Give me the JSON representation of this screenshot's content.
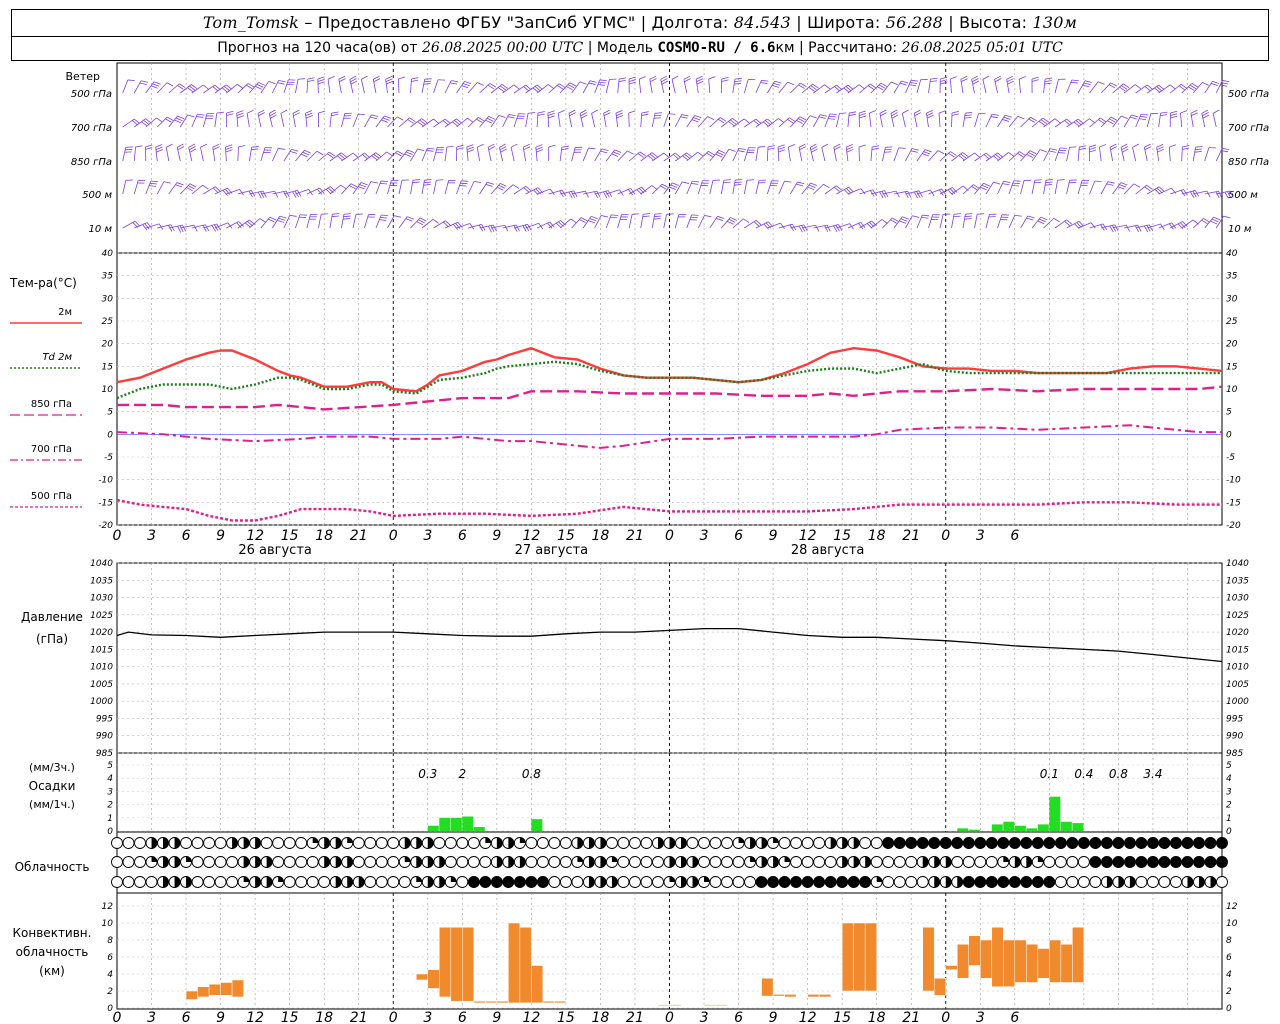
{
  "header": {
    "station": "Tom_Tomsk",
    "provider": " – Предоставлено ФГБУ \"ЗапСиб УГМС\" | Долгота: ",
    "lon": "84.543",
    "lat_label": " | Широта: ",
    "lat": "56.288",
    "alt_label": " | Высота: ",
    "alt": "130м",
    "forecast_label": "Прогноз на 120 часа(ов) от ",
    "forecast_time": "26.08.2025 00:00 UTC",
    "model_label": "  | Модель ",
    "model": "COSMO-RU / 6.6",
    "model_unit": "км",
    "calc_label": " | Рассчитано: ",
    "calc_time": "26.08.2025 05:01 UTC"
  },
  "time_axis": {
    "hour_labels": [
      "0",
      "3",
      "6",
      "9",
      "12",
      "15",
      "18",
      "21",
      "0",
      "3",
      "6",
      "9",
      "12",
      "15",
      "18",
      "21",
      "0",
      "3",
      "6",
      "9",
      "12",
      "15",
      "18",
      "21",
      "0",
      "3",
      "6"
    ],
    "day_labels": [
      {
        "text": "26 августа",
        "hour": 12
      },
      {
        "text": "27 августа",
        "hour": 36
      },
      {
        "text": "28 августа",
        "hour": 60
      }
    ]
  },
  "wind_panel": {
    "title": "Ветер",
    "levels": [
      "500 гПа",
      "700 гПа",
      "850 гПа",
      "500 м",
      "10 м"
    ],
    "color": "#7b3fe4"
  },
  "temp_panel": {
    "title": "Тем-ра(°C)",
    "legend": [
      {
        "label": "2м",
        "color": "#ff3b3b",
        "dash": "solid"
      },
      {
        "label": "2м",
        "prefix": "Td",
        "color": "#1a7f1a",
        "dash": "dotted"
      },
      {
        "label": "850 гПа",
        "color": "#e0208a",
        "dash": "long-dash"
      },
      {
        "label": "700 гПа",
        "color": "#e0208a",
        "dash": "dash-dot"
      },
      {
        "label": "500 гПа",
        "color": "#e0208a",
        "dash": "short-dash"
      }
    ],
    "y_ticks": [
      "40",
      "35",
      "30",
      "25",
      "20",
      "15",
      "10",
      "5",
      "0",
      "-5",
      "-10",
      "-15",
      "-20"
    ]
  },
  "pressure_panel": {
    "title": "Давление",
    "unit": "(гПа)",
    "y_ticks": [
      "1040",
      "1035",
      "1030",
      "1025",
      "1020",
      "1015",
      "1010",
      "1005",
      "1000",
      "995",
      "990",
      "985"
    ]
  },
  "precip_panel": {
    "unit_top": "(мм/3ч.)",
    "title": "Осадки",
    "unit_bottom": "(мм/1ч.)",
    "y_ticks": [
      "5",
      "4",
      "3",
      "2",
      "1",
      "0"
    ],
    "totals": [
      {
        "text": "0.3",
        "hour": 27
      },
      {
        "text": "2",
        "hour": 30
      },
      {
        "text": "0.8",
        "hour": 36
      },
      {
        "text": "0.1",
        "hour": 81
      },
      {
        "text": "0.4",
        "hour": 84
      },
      {
        "text": "0.8",
        "hour": 87
      },
      {
        "text": "3.4",
        "hour": 90
      }
    ],
    "color": "#22dd22"
  },
  "cloud_panel": {
    "title": "Облачность"
  },
  "conv_panel": {
    "title_lines": [
      "Конвективн.",
      "облачность",
      "(км)"
    ],
    "y_ticks": [
      "12",
      "10",
      "8",
      "6",
      "4",
      "2",
      "0"
    ],
    "color": "#f08a2c"
  },
  "chart_data": [
    {
      "type": "line",
      "title": "Тем-ра(°C)",
      "x_unit": "hours from 26.08.2025 00:00 UTC",
      "ylim": [
        -20,
        40
      ],
      "series": [
        {
          "name": "2м",
          "x": [
            0,
            2,
            4,
            6,
            8,
            9,
            10,
            12,
            14,
            15,
            16,
            18,
            20,
            22,
            23,
            24,
            26,
            27,
            28,
            30,
            32,
            33,
            34,
            36,
            38,
            40,
            42,
            44,
            46,
            48,
            50,
            52,
            54,
            56,
            58,
            60,
            62,
            63,
            64,
            66,
            68,
            70,
            72,
            74,
            76,
            78,
            80,
            82,
            84,
            86,
            88,
            90,
            92,
            94,
            96
          ],
          "y": [
            11.5,
            12.5,
            14.5,
            16.5,
            18,
            18.5,
            18.5,
            16.5,
            14,
            13,
            12.5,
            10.5,
            10.5,
            11.5,
            11.5,
            10,
            9.5,
            11,
            13,
            14,
            16,
            16.5,
            17.5,
            19,
            17,
            16.5,
            14.5,
            13,
            12.5,
            12.5,
            12.5,
            12,
            11.5,
            12,
            13.5,
            15.5,
            18,
            18.5,
            19,
            18.5,
            17,
            15,
            14.5,
            14.5,
            14,
            14,
            13.5,
            13.5,
            13.5,
            13.5,
            14.5,
            15,
            15,
            14.5,
            14
          ]
        },
        {
          "name": "Td 2м",
          "x": [
            0,
            2,
            4,
            6,
            8,
            9,
            10,
            12,
            14,
            15,
            16,
            18,
            20,
            22,
            23,
            24,
            26,
            27,
            28,
            30,
            32,
            33,
            34,
            36,
            38,
            40,
            42,
            44,
            46,
            48,
            50,
            52,
            54,
            56,
            58,
            60,
            62,
            63,
            64,
            66,
            68,
            70,
            72,
            74,
            76,
            78,
            80,
            82,
            84,
            86,
            88,
            90,
            92,
            94,
            96
          ],
          "y": [
            8,
            10,
            11,
            11,
            11,
            10.5,
            10,
            11,
            12.5,
            12.5,
            12,
            10,
            10,
            11,
            11,
            9.5,
            9,
            10.5,
            12,
            12.5,
            13.5,
            14.5,
            15,
            15.5,
            16,
            15.5,
            14,
            13,
            12.5,
            12.5,
            12.5,
            12,
            11.5,
            12,
            13,
            14,
            14.5,
            14.5,
            14.5,
            13.5,
            14.5,
            15.5,
            14,
            13.5,
            13.5,
            13.5,
            13.5,
            13.5,
            13.5,
            13.5,
            13.5,
            13.5,
            13.5,
            13.5,
            13.5
          ]
        },
        {
          "name": "850 гПа",
          "x": [
            0,
            4,
            6,
            8,
            12,
            14,
            16,
            18,
            24,
            28,
            30,
            32,
            34,
            36,
            40,
            44,
            48,
            52,
            56,
            60,
            62,
            64,
            66,
            68,
            72,
            76,
            80,
            84,
            88,
            92,
            94,
            96
          ],
          "y": [
            6.5,
            6.5,
            6,
            6,
            6,
            6.5,
            6,
            5.5,
            6.5,
            7.5,
            8,
            8,
            8,
            9.5,
            9.5,
            9,
            9,
            9,
            8.5,
            8.5,
            9,
            8.5,
            9,
            9.5,
            9.5,
            10,
            9.5,
            10,
            10,
            10,
            10,
            10.5
          ]
        },
        {
          "name": "700 гПа",
          "x": [
            0,
            4,
            8,
            12,
            16,
            18,
            22,
            24,
            28,
            30,
            32,
            34,
            36,
            40,
            42,
            44,
            48,
            52,
            56,
            60,
            64,
            66,
            68,
            72,
            76,
            80,
            84,
            88,
            92,
            94,
            96
          ],
          "y": [
            0.5,
            0,
            -1,
            -1.5,
            -1,
            -0.5,
            -0.5,
            -1,
            -1,
            -0.5,
            -1,
            -1.5,
            -1.5,
            -2.5,
            -3,
            -2.5,
            -1,
            -1,
            -0.5,
            -0.5,
            -0.5,
            0,
            1,
            1.5,
            1.5,
            1,
            1.5,
            2,
            1,
            0.5,
            0.5
          ]
        },
        {
          "name": "500 гПа",
          "x": [
            0,
            2,
            4,
            6,
            8,
            10,
            12,
            14,
            16,
            18,
            20,
            22,
            24,
            28,
            32,
            36,
            40,
            44,
            48,
            52,
            56,
            60,
            64,
            68,
            72,
            76,
            80,
            84,
            88,
            92,
            96
          ],
          "y": [
            -14.5,
            -15.5,
            -16,
            -16.5,
            -18,
            -19,
            -19,
            -18,
            -16.5,
            -16.5,
            -16.5,
            -17,
            -18,
            -17.5,
            -17.5,
            -18,
            -17.5,
            -16,
            -17,
            -17,
            -17,
            -17,
            -16.5,
            -15.5,
            -15.5,
            -15.5,
            -15.5,
            -15,
            -15,
            -15.5,
            -15.5
          ]
        }
      ]
    },
    {
      "type": "line",
      "title": "Давление",
      "ylim": [
        985,
        1040
      ],
      "series": [
        {
          "name": "Давление",
          "x": [
            0,
            1,
            3,
            6,
            9,
            12,
            15,
            18,
            21,
            24,
            27,
            30,
            33,
            36,
            39,
            42,
            45,
            48,
            51,
            54,
            57,
            60,
            63,
            66,
            69,
            72,
            75,
            78,
            81,
            84,
            87,
            90,
            93,
            96
          ],
          "y": [
            1019,
            1020,
            1019.2,
            1019,
            1018.5,
            1019,
            1019.5,
            1020,
            1020,
            1020,
            1019.5,
            1019,
            1018.8,
            1018.8,
            1019.5,
            1020,
            1020,
            1020.5,
            1021,
            1021,
            1020,
            1019,
            1018.5,
            1018.5,
            1018,
            1017.5,
            1016.8,
            1016,
            1015.5,
            1015,
            1014.5,
            1013.5,
            1012.5,
            1011.5
          ]
        }
      ]
    },
    {
      "type": "bar",
      "title": "Осадки",
      "ylim": [
        0,
        5
      ],
      "series": [
        {
          "name": "Осадки",
          "x": [
            26,
            27,
            28,
            29,
            30,
            31,
            35,
            36,
            73,
            74,
            75,
            76,
            77,
            78,
            79,
            80,
            81,
            82,
            83,
            84,
            85
          ],
          "y": [
            0,
            0.4,
            1,
            1,
            1.1,
            0.3,
            0,
            0.9,
            0.2,
            0.1,
            0,
            0.5,
            0.7,
            0.4,
            0.2,
            0.5,
            2.6,
            0.7,
            0.6,
            0,
            0
          ]
        }
      ]
    },
    {
      "type": "bar",
      "title": "Конвективн. облачность (км)",
      "ylim": [
        0,
        13
      ],
      "series": [
        {
          "name": "Конвективн. облачность",
          "x": [
            6,
            7,
            8,
            9,
            10,
            26,
            27,
            28,
            29,
            30,
            31,
            32,
            33,
            34,
            35,
            36,
            37,
            38,
            47,
            48,
            51,
            52,
            56,
            57,
            58,
            60,
            61,
            63,
            64,
            65,
            70,
            71,
            72,
            73,
            74,
            75,
            76,
            77,
            78,
            79,
            80,
            81,
            82,
            83
          ],
          "y": [
            [
              1,
              2
            ],
            [
              1.3,
              2.5
            ],
            [
              1.5,
              2.8
            ],
            [
              1.5,
              3
            ],
            [
              1.3,
              3.3
            ],
            [
              3.3,
              4
            ],
            [
              2.3,
              4.5
            ],
            [
              1.3,
              9.5
            ],
            [
              0.8,
              9.5
            ],
            [
              0.8,
              9.5
            ],
            [
              0.6,
              0.8
            ],
            [
              0.6,
              0.8
            ],
            [
              0.6,
              0.8
            ],
            [
              0.6,
              10
            ],
            [
              0.6,
              9.5
            ],
            [
              0.6,
              5
            ],
            [
              0.6,
              0.8
            ],
            [
              0.6,
              0.8
            ],
            [
              0.3,
              0.4
            ],
            [
              0.3,
              0.4
            ],
            [
              0.3,
              0.4
            ],
            [
              0.3,
              0.4
            ],
            [
              1.4,
              3.5
            ],
            [
              1.4,
              1.6
            ],
            [
              1.3,
              1.6
            ],
            [
              1.3,
              1.6
            ],
            [
              1.3,
              1.6
            ],
            [
              2,
              10
            ],
            [
              2,
              10
            ],
            [
              2,
              10
            ],
            [
              2,
              9.5
            ],
            [
              1.5,
              3.5
            ],
            [
              4.5,
              5
            ],
            [
              3.5,
              7.5
            ],
            [
              5,
              8.5
            ],
            [
              3.5,
              8
            ],
            [
              2.5,
              9.5
            ],
            [
              2.5,
              8
            ],
            [
              3,
              8
            ],
            [
              3,
              7.5
            ],
            [
              3.5,
              7
            ],
            [
              3,
              8
            ],
            [
              3,
              7.5
            ],
            [
              3,
              9.5
            ]
          ]
        }
      ]
    }
  ]
}
